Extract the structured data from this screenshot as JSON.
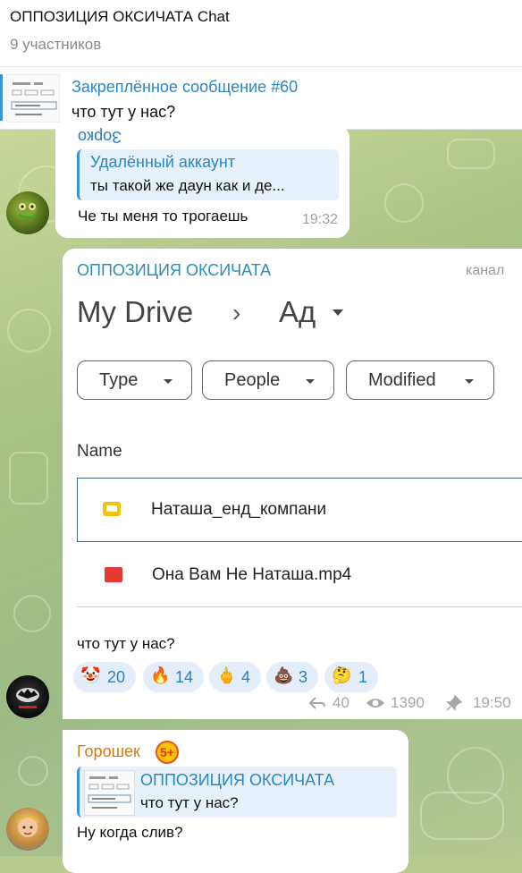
{
  "header": {
    "title": "ОППОЗИЦИЯ ОКСИЧАТА Chat",
    "subtitle": "9 участников"
  },
  "pinned": {
    "title": "Закреплённое сообщение #60",
    "text": "что тут у нас?"
  },
  "messages": [
    {
      "sender": "Зорко",
      "quote_author": "Удалённый аккаунт",
      "quote_text": "ты такой же даун как и де...",
      "text": "Че ты меня то трогаешь",
      "time": "19:32"
    },
    {
      "sender": "ОППОЗИЦИЯ ОКСИЧАТА",
      "sender_tag": "канал",
      "drive": {
        "title": "My Drive",
        "separator": "›",
        "folder": "Ад",
        "filters": [
          "Type",
          "People",
          "Modified"
        ],
        "column_header": "Name",
        "files": [
          "Наташа_енд_компани",
          "Она Вам Не Наташа.mp4"
        ]
      },
      "text": "что тут у нас?",
      "reactions": [
        {
          "emoji": "🤡",
          "count": "20"
        },
        {
          "emoji": "🔥",
          "count": "14"
        },
        {
          "emoji": "🖕",
          "count": "4"
        },
        {
          "emoji": "💩",
          "count": "3"
        },
        {
          "emoji": "🤔",
          "count": "1"
        }
      ],
      "replies": "40",
      "views": "1390",
      "time": "19:50"
    },
    {
      "sender": "Горошек",
      "sender_badge": "5+",
      "quote_author": "ОППОЗИЦИЯ ОКСИЧАТА",
      "quote_text": "что тут у нас?",
      "text": "Ну когда слив?"
    }
  ],
  "colors": {
    "accent": "#2a87c6",
    "reaction_bg": "#e4eefa",
    "sender_orange": "#d07a17"
  }
}
